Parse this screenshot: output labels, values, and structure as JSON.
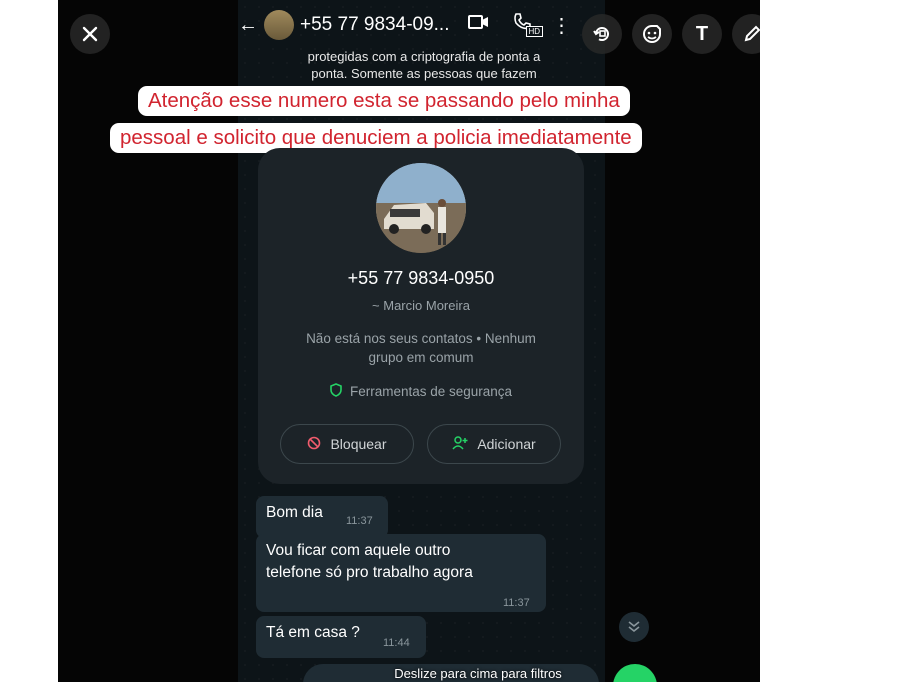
{
  "editor": {
    "close_icon": "close-icon",
    "tools": [
      "crop-rotate-icon",
      "sticker-icon",
      "text-icon",
      "pen-icon"
    ],
    "text_tool_label": "T"
  },
  "chat_header": {
    "back_icon": "arrow-left-icon",
    "title": "+55 77 9834-09...",
    "icons": [
      "video-icon",
      "call-icon",
      "more-vert-icon"
    ],
    "hd_badge": "HD"
  },
  "encryption_notice": {
    "line1": "protegidas com a criptografia de ponta a",
    "line2": "ponta. Somente as pessoas que fazem"
  },
  "overlay_text": {
    "line1": "Atenção esse numero esta se passando pelo minha",
    "line2": "pessoal e solicito que denuciem a policia imediatamente",
    "color": "#d1242f"
  },
  "contact_card": {
    "phone": "+55 77 9834-0950",
    "name": "~ Marcio Moreira",
    "info_line1": "Não está nos seus contatos • Nenhum",
    "info_line2": "grupo em comum",
    "security_label": "Ferramentas de segurança",
    "block_label": "Bloquear",
    "add_label": "Adicionar",
    "accent": "#25d366",
    "block_color": "#f15c6d"
  },
  "messages": [
    {
      "text": "Bom dia",
      "time": "11:37"
    },
    {
      "text_line1": "Vou ficar com aquele outro",
      "text_line2": "telefone só pro trabalho agora",
      "time": "11:37"
    },
    {
      "text": "Tá em casa ?",
      "time": "11:44"
    }
  ],
  "bottom_hint": "Deslize para cima para filtros"
}
